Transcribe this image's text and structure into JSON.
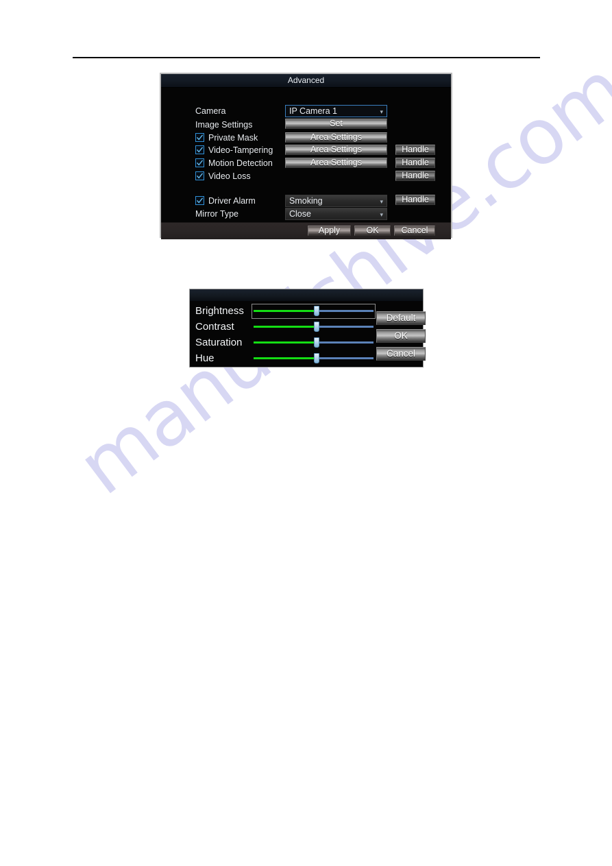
{
  "page": {
    "watermark": "manualshive.com",
    "watermark_color": "#c8c8ef"
  },
  "advanced_dialog": {
    "title": "Advanced",
    "rows": {
      "camera": {
        "label": "Camera",
        "dropdown_value": "IP Camera 1",
        "arrow": "chevron-down-icon"
      },
      "image_settings": {
        "label": "Image Settings",
        "button": "Set"
      },
      "private_mask": {
        "label": "Private Mask",
        "checked": true,
        "button": "Area Settings"
      },
      "video_tampering": {
        "label": "Video-Tampering",
        "checked": true,
        "button": "Area Settings",
        "handle": "Handle"
      },
      "motion_detection": {
        "label": "Motion Detection",
        "checked": true,
        "button": "Area Settings",
        "handle": "Handle"
      },
      "video_loss": {
        "label": "Video Loss",
        "checked": true,
        "handle": "Handle"
      },
      "driver_alarm": {
        "label": "Driver Alarm",
        "checked": true,
        "dropdown_value": "Smoking",
        "handle": "Handle"
      },
      "mirror_type": {
        "label": "Mirror Type",
        "dropdown_value": "Close"
      }
    },
    "footer": {
      "apply": "Apply",
      "ok": "OK",
      "cancel": "Cancel"
    }
  },
  "image_settings_dialog": {
    "sliders": [
      {
        "label": "Brightness",
        "value": 50,
        "focused": true
      },
      {
        "label": "Contrast",
        "value": 50,
        "focused": false
      },
      {
        "label": "Saturation",
        "value": 50,
        "focused": false
      },
      {
        "label": "Hue",
        "value": 50,
        "focused": false
      }
    ],
    "buttons": {
      "default": "Default",
      "ok": "OK",
      "cancel": "Cancel"
    },
    "colors": {
      "fill": "#14dd14",
      "track": "#5b82b8"
    }
  }
}
